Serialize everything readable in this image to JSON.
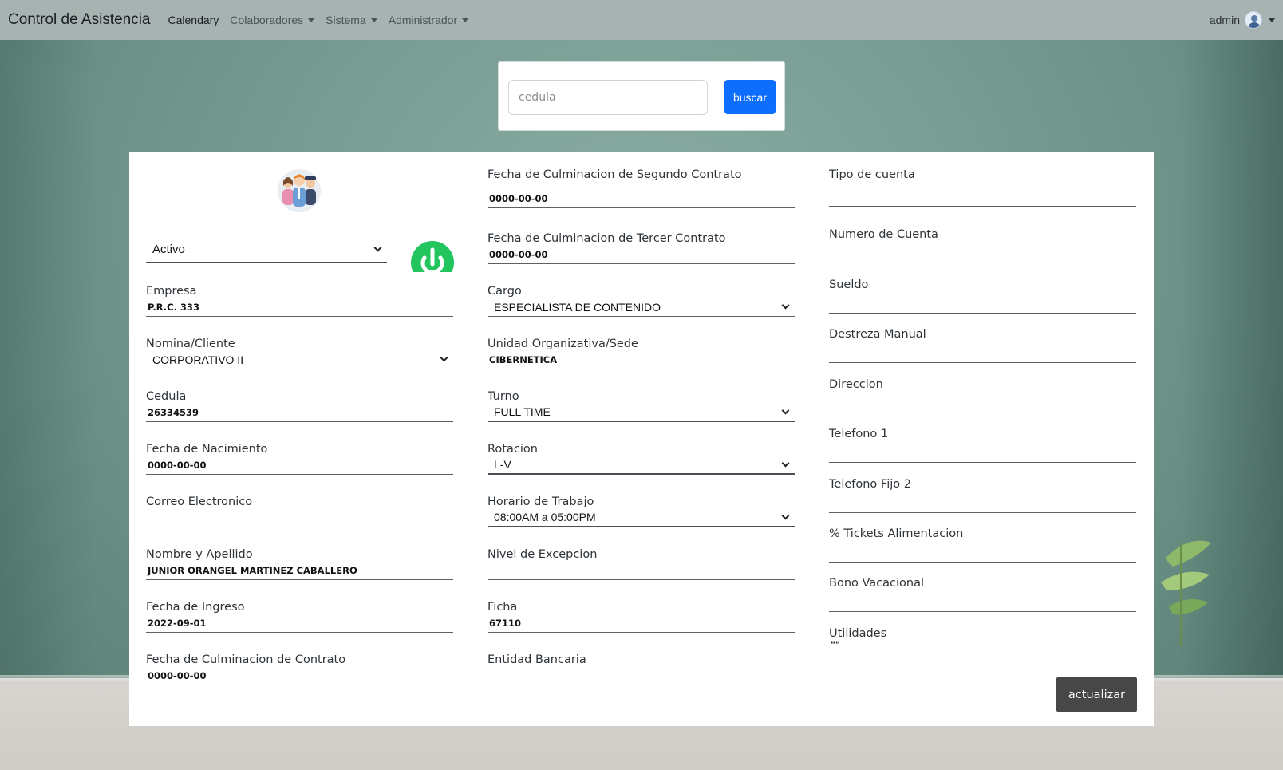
{
  "navbar": {
    "brand": "Control de Asistencia",
    "items": [
      {
        "label": "Calendary",
        "dropdown": false
      },
      {
        "label": "Colaboradores",
        "dropdown": true
      },
      {
        "label": "Sistema",
        "dropdown": true
      },
      {
        "label": "Administrador",
        "dropdown": true
      }
    ],
    "user": "admin"
  },
  "search": {
    "placeholder": "cedula",
    "button_label": "buscar"
  },
  "status": {
    "selected": "Activo",
    "icon": "power-icon",
    "icon_color": "#22c55e"
  },
  "form": {
    "col1": [
      {
        "label": "Empresa",
        "value": "P.R.C. 333",
        "type": "text"
      },
      {
        "label": "Nomina/Cliente",
        "value": "CORPORATIVO II",
        "type": "select"
      },
      {
        "label": "Cedula",
        "value": "26334539",
        "type": "text"
      },
      {
        "label": "Fecha de Nacimiento",
        "value": "0000-00-00",
        "type": "text"
      },
      {
        "label": "Correo Electronico",
        "value": "",
        "type": "text"
      },
      {
        "label": "Nombre y Apellido",
        "value": "JUNIOR ORANGEL MARTINEZ CABALLERO",
        "type": "text"
      },
      {
        "label": "Fecha de Ingreso",
        "value": "2022-09-01",
        "type": "text"
      },
      {
        "label": "Fecha de Culminacion de Contrato",
        "value": "0000-00-00",
        "type": "text"
      }
    ],
    "col2": [
      {
        "label": "Fecha de Culminacion de Segundo Contrato",
        "value": "0000-00-00",
        "type": "text"
      },
      {
        "label": "Fecha de Culminacion de Tercer Contrato",
        "value": "0000-00-00",
        "type": "text"
      },
      {
        "label": "Cargo",
        "value": "ESPECIALISTA DE CONTENIDO",
        "type": "select"
      },
      {
        "label": "Unidad Organizativa/Sede",
        "value": "CIBERNETICA",
        "type": "text"
      },
      {
        "label": "Turno",
        "value": "FULL TIME",
        "type": "select"
      },
      {
        "label": "Rotacion",
        "value": "L-V",
        "type": "select"
      },
      {
        "label": "Horario de Trabajo",
        "value": "08:00AM a 05:00PM",
        "type": "select"
      },
      {
        "label": "Nivel de Excepcion",
        "value": "",
        "type": "text"
      },
      {
        "label": "Ficha",
        "value": "67110",
        "type": "text"
      },
      {
        "label": "Entidad Bancaria",
        "value": "",
        "type": "text"
      }
    ],
    "col3": [
      {
        "label": "Tipo de cuenta",
        "value": "",
        "type": "text"
      },
      {
        "label": "Numero de Cuenta",
        "value": "",
        "type": "text"
      },
      {
        "label": "Sueldo",
        "value": "",
        "type": "text"
      },
      {
        "label": "Destreza Manual",
        "value": "",
        "type": "text"
      },
      {
        "label": "Direccion",
        "value": "",
        "type": "text"
      },
      {
        "label": "Telefono 1",
        "value": "",
        "type": "text"
      },
      {
        "label": "Telefono Fijo 2",
        "value": "",
        "type": "text"
      },
      {
        "label": "% Tickets Alimentacion",
        "value": "",
        "type": "text"
      },
      {
        "label": "Bono Vacacional",
        "value": "",
        "type": "text"
      },
      {
        "label": "Utilidades",
        "value": "\"\"",
        "type": "text"
      }
    ],
    "submit_label": "actualizar"
  }
}
